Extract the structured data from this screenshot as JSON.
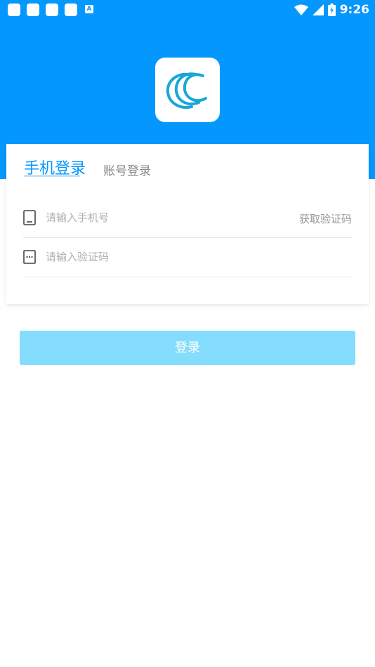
{
  "status_bar": {
    "time": "9:26",
    "notification_icons": [
      "app-notification-icon",
      "app-notification-icon",
      "app-notification-icon",
      "app-notification-icon",
      "a-letter-notification-icon"
    ],
    "a_letter": "A",
    "system_icons": [
      "wifi-icon",
      "signal-icon",
      "battery-charging-icon"
    ]
  },
  "colors": {
    "primary": "#0497fd",
    "button_disabled": "#84ddfd",
    "tab_underline": "#bfe3fb"
  },
  "tabs": {
    "phone_login": "手机登录",
    "account_login": "账号登录",
    "active": "phone_login"
  },
  "form": {
    "phone_placeholder": "请输入手机号",
    "get_code_label": "获取验证码",
    "code_placeholder": "请输入验证码"
  },
  "login_button_label": "登录"
}
